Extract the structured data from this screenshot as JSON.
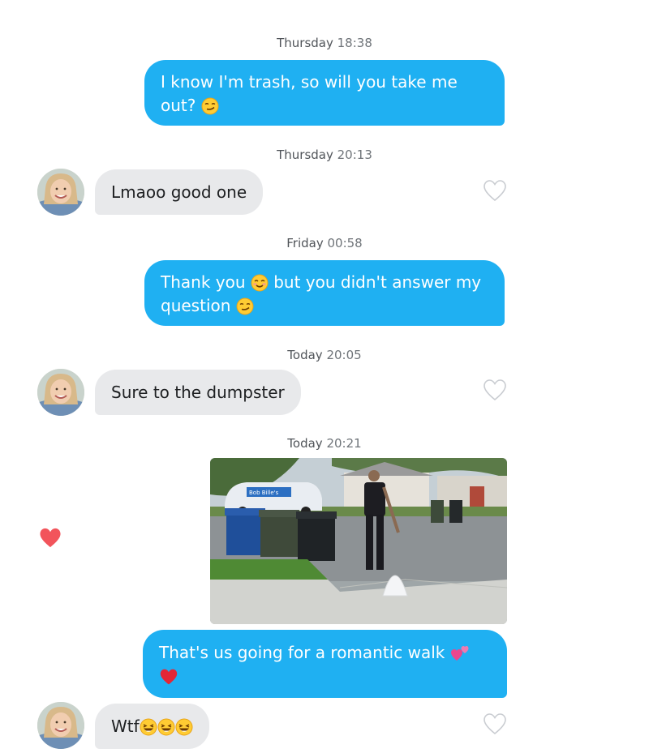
{
  "conversation": {
    "messages": [
      {
        "timestamp_day": "Thursday",
        "timestamp_time": "18:38",
        "text": "I know I'm trash, so will you take me out?",
        "emojis": [
          "smirk"
        ]
      },
      {
        "timestamp_day": "Thursday",
        "timestamp_time": "20:13",
        "text": "Lmaoo good one"
      },
      {
        "timestamp_day": "Friday",
        "timestamp_time": "00:58",
        "text_part1": "Thank you",
        "text_part2": "but you didn't answer my question",
        "emojis": [
          "blush",
          "smirk"
        ]
      },
      {
        "timestamp_day": "Today",
        "timestamp_time": "20:05",
        "text": "Sure to the dumpster"
      },
      {
        "timestamp_day": "Today",
        "timestamp_time": "20:21",
        "image_text": "Bob Bille's",
        "reaction": "liked"
      },
      {
        "text": "That's us going for a romantic walk",
        "emojis": [
          "two-hearts",
          "red-heart"
        ]
      },
      {
        "text": "Wtf",
        "emojis": [
          "laughing",
          "laughing",
          "laughing"
        ]
      }
    ]
  },
  "colors": {
    "outgoing_bubble": "#1fb0f2",
    "incoming_bubble": "#e8e9eb",
    "like_heart": "#f2545b"
  },
  "icons": [
    "smirk-emoji-icon",
    "blush-emoji-icon",
    "two-hearts-icon",
    "red-heart-icon",
    "laughing-emoji-icon",
    "heart-outline-icon",
    "heart-filled-icon",
    "avatar"
  ]
}
